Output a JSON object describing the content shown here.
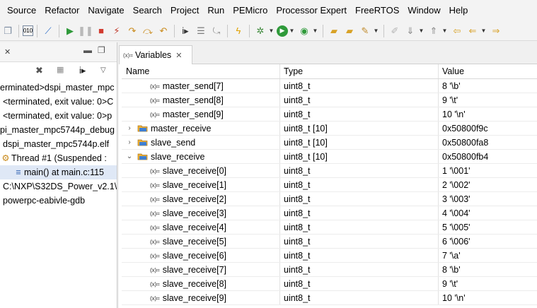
{
  "menubar": {
    "items": [
      "Source",
      "Refactor",
      "Navigate",
      "Search",
      "Project",
      "Run",
      "PEMicro",
      "Processor Expert",
      "FreeRTOS",
      "Window",
      "Help"
    ]
  },
  "debug": {
    "lines": [
      {
        "text": "erminated>dspi_master_mpc",
        "icon": ""
      },
      {
        "text": "<terminated, exit value: 0>C",
        "icon": ""
      },
      {
        "text": "<terminated, exit value: 0>p",
        "icon": ""
      },
      {
        "text": "pi_master_mpc5744p_debug",
        "icon": ""
      },
      {
        "text": "dspi_master_mpc5744p.elf",
        "icon": ""
      },
      {
        "text": "Thread #1 (Suspended :",
        "icon": "thread"
      },
      {
        "text": "main() at main.c:115",
        "icon": "frame"
      },
      {
        "text": "C:\\NXP\\S32DS_Power_v2.1\\",
        "icon": ""
      },
      {
        "text": "powerpc-eabivle-gdb",
        "icon": ""
      }
    ]
  },
  "variables": {
    "tab_label": "Variables",
    "tab_icon_text": "(x)=",
    "columns": {
      "name": "Name",
      "type": "Type",
      "value": "Value"
    },
    "rows": [
      {
        "name": "master_send[7]",
        "type": "uint8_t",
        "value": "8 '\\b'",
        "kind": "prim",
        "indent": 1,
        "expander": ""
      },
      {
        "name": "master_send[8]",
        "type": "uint8_t",
        "value": "9 '\\t'",
        "kind": "prim",
        "indent": 1,
        "expander": ""
      },
      {
        "name": "master_send[9]",
        "type": "uint8_t",
        "value": "10 '\\n'",
        "kind": "prim",
        "indent": 1,
        "expander": ""
      },
      {
        "name": "master_receive",
        "type": "uint8_t [10]",
        "value": "0x50800f9c",
        "kind": "array",
        "indent": 0,
        "expander": "›"
      },
      {
        "name": "slave_send",
        "type": "uint8_t [10]",
        "value": "0x50800fa8",
        "kind": "array",
        "indent": 0,
        "expander": "›"
      },
      {
        "name": "slave_receive",
        "type": "uint8_t [10]",
        "value": "0x50800fb4",
        "kind": "array",
        "indent": 0,
        "expander": "⌄"
      },
      {
        "name": "slave_receive[0]",
        "type": "uint8_t",
        "value": "1 '\\001'",
        "kind": "prim",
        "indent": 1,
        "expander": ""
      },
      {
        "name": "slave_receive[1]",
        "type": "uint8_t",
        "value": "2 '\\002'",
        "kind": "prim",
        "indent": 1,
        "expander": ""
      },
      {
        "name": "slave_receive[2]",
        "type": "uint8_t",
        "value": "3 '\\003'",
        "kind": "prim",
        "indent": 1,
        "expander": ""
      },
      {
        "name": "slave_receive[3]",
        "type": "uint8_t",
        "value": "4 '\\004'",
        "kind": "prim",
        "indent": 1,
        "expander": ""
      },
      {
        "name": "slave_receive[4]",
        "type": "uint8_t",
        "value": "5 '\\005'",
        "kind": "prim",
        "indent": 1,
        "expander": ""
      },
      {
        "name": "slave_receive[5]",
        "type": "uint8_t",
        "value": "6 '\\006'",
        "kind": "prim",
        "indent": 1,
        "expander": ""
      },
      {
        "name": "slave_receive[6]",
        "type": "uint8_t",
        "value": "7 '\\a'",
        "kind": "prim",
        "indent": 1,
        "expander": ""
      },
      {
        "name": "slave_receive[7]",
        "type": "uint8_t",
        "value": "8 '\\b'",
        "kind": "prim",
        "indent": 1,
        "expander": ""
      },
      {
        "name": "slave_receive[8]",
        "type": "uint8_t",
        "value": "9 '\\t'",
        "kind": "prim",
        "indent": 1,
        "expander": ""
      },
      {
        "name": "slave_receive[9]",
        "type": "uint8_t",
        "value": "10 '\\n'",
        "kind": "prim",
        "indent": 1,
        "expander": ""
      }
    ]
  },
  "colors": {
    "selection": "#dfe8f6",
    "struct_icon": "#3f7fd1",
    "struct_icon_accent": "#f2b233"
  }
}
